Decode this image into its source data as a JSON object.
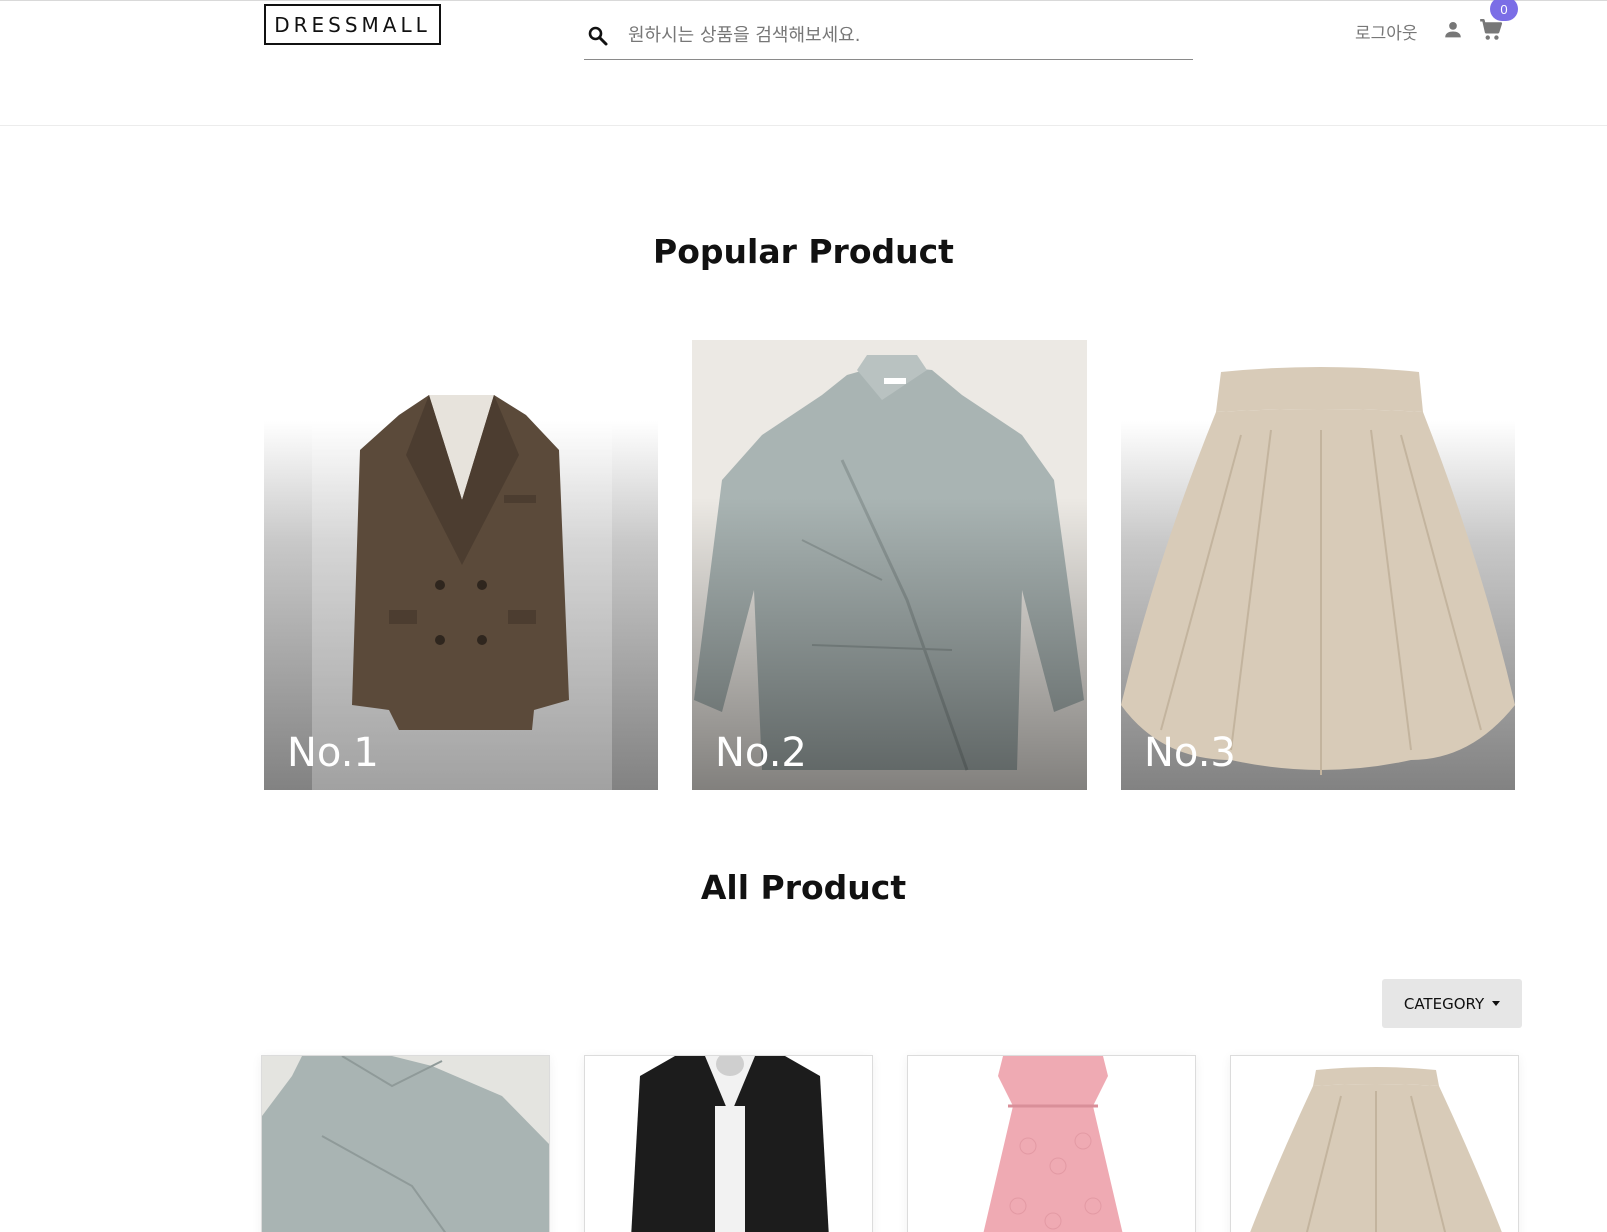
{
  "header": {
    "logo": "DRESSMALL",
    "search_placeholder": "원하시는 상품을 검색해보세요.",
    "search_icon": "search-icon",
    "logout_label": "로그아웃",
    "user_icon": "person-icon",
    "cart_icon": "shopping-cart-icon",
    "cart_count": "0"
  },
  "popular": {
    "title": "Popular Product",
    "items": [
      {
        "label": "No.1",
        "item": "brown double-breasted blazer"
      },
      {
        "label": "No.2",
        "item": "light grey-blue shirt"
      },
      {
        "label": "No.3",
        "item": "beige flared skirt"
      }
    ]
  },
  "all": {
    "title": "All Product",
    "category_label": "CATEGORY",
    "items": [
      {
        "item": "light grey-blue shirt"
      },
      {
        "item": "black shirt with white tee"
      },
      {
        "item": "pink lace dress"
      },
      {
        "item": "beige flared skirt"
      }
    ]
  },
  "colors": {
    "badge": "#7b6ee6",
    "jacket": "#5b4a3a",
    "shirt": "#a9b4b3",
    "skirt": "#d8cbb8",
    "black_shirt": "#1c1c1c",
    "pink_dress": "#efaab3"
  }
}
